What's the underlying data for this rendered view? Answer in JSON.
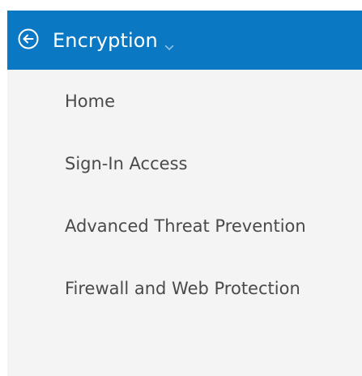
{
  "header": {
    "title": "Encryption",
    "back_icon": "back-arrow-circle-icon",
    "dropdown_icon": "chevron-down-icon"
  },
  "nav": {
    "items": [
      {
        "label": "Home"
      },
      {
        "label": "Sign-In Access"
      },
      {
        "label": "Advanced Threat Prevention"
      },
      {
        "label": "Firewall and Web Protection"
      }
    ]
  },
  "colors": {
    "header_bg": "#0a78c2",
    "panel_bg": "#f4f4f4",
    "nav_text": "#4a4a4a",
    "header_text": "#ffffff"
  }
}
